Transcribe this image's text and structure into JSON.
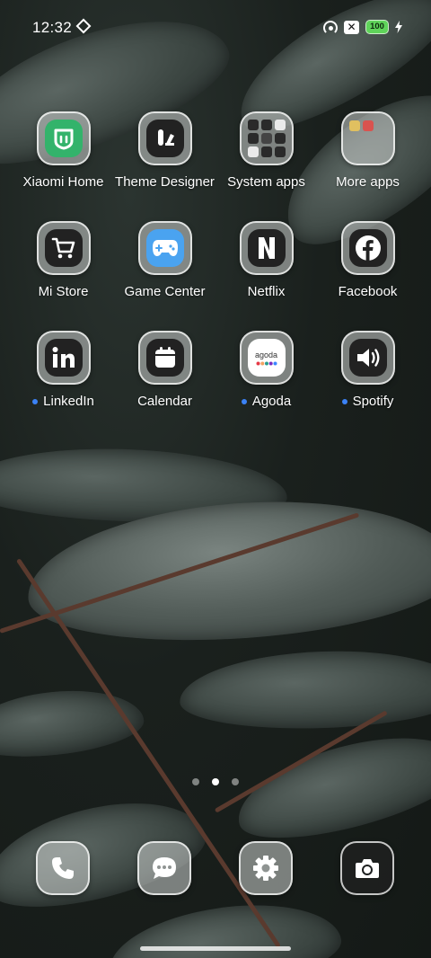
{
  "status_bar": {
    "time": "12:32",
    "battery_level": "100",
    "icons": [
      "hotspot-icon",
      "sim-off-icon",
      "battery-icon",
      "charging-bolt-icon"
    ]
  },
  "home": {
    "apps": [
      {
        "label": "Xiaomi Home",
        "icon": "xiaomi-home-icon",
        "new_dot": false
      },
      {
        "label": "Theme Designer",
        "icon": "theme-designer-icon",
        "new_dot": false
      },
      {
        "label": "System apps",
        "icon": "folder-icon",
        "new_dot": false
      },
      {
        "label": "More apps",
        "icon": "folder-icon",
        "new_dot": false
      },
      {
        "label": "Mi Store",
        "icon": "shopping-cart-icon",
        "new_dot": false
      },
      {
        "label": "Game Center",
        "icon": "gamepad-icon",
        "new_dot": false
      },
      {
        "label": "Netflix",
        "icon": "netflix-icon",
        "new_dot": false
      },
      {
        "label": "Facebook",
        "icon": "facebook-icon",
        "new_dot": false
      },
      {
        "label": "LinkedIn",
        "icon": "linkedin-icon",
        "new_dot": true
      },
      {
        "label": "Calendar",
        "icon": "calendar-icon",
        "new_dot": false
      },
      {
        "label": "Agoda",
        "icon": "agoda-icon",
        "new_dot": true
      },
      {
        "label": "Spotify",
        "icon": "speaker-icon",
        "new_dot": true
      }
    ],
    "agoda_logo_text": "agoda",
    "pages": {
      "count": 3,
      "current": 2
    }
  },
  "dock": {
    "apps": [
      {
        "icon": "phone-icon"
      },
      {
        "icon": "messages-icon"
      },
      {
        "icon": "settings-gear-icon"
      },
      {
        "icon": "camera-icon"
      }
    ]
  },
  "colors": {
    "new_dot": "#3b82f6",
    "battery_fill": "#5fd35a",
    "xiaomi_home_green": "#33b36b"
  }
}
